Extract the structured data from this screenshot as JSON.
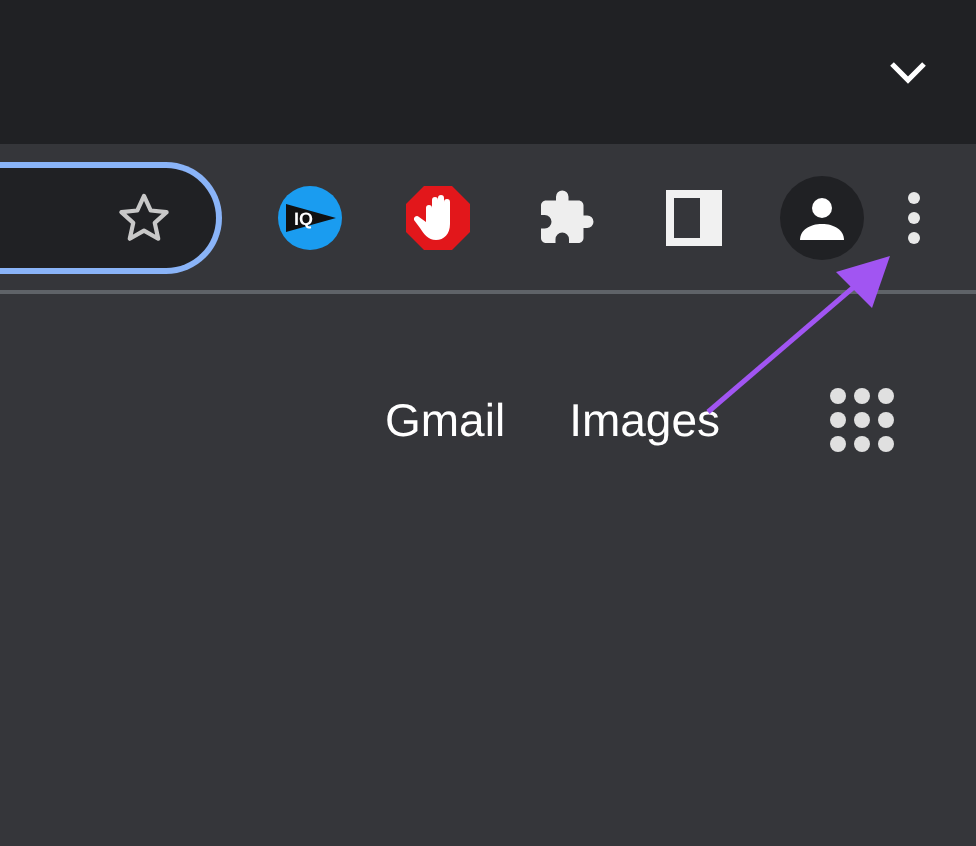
{
  "extensions": [
    {
      "kind": "iq",
      "label": "IQ"
    },
    {
      "kind": "stop"
    },
    {
      "kind": "puzzle"
    },
    {
      "kind": "panel"
    }
  ],
  "links": [
    "Gmail",
    "Images"
  ]
}
